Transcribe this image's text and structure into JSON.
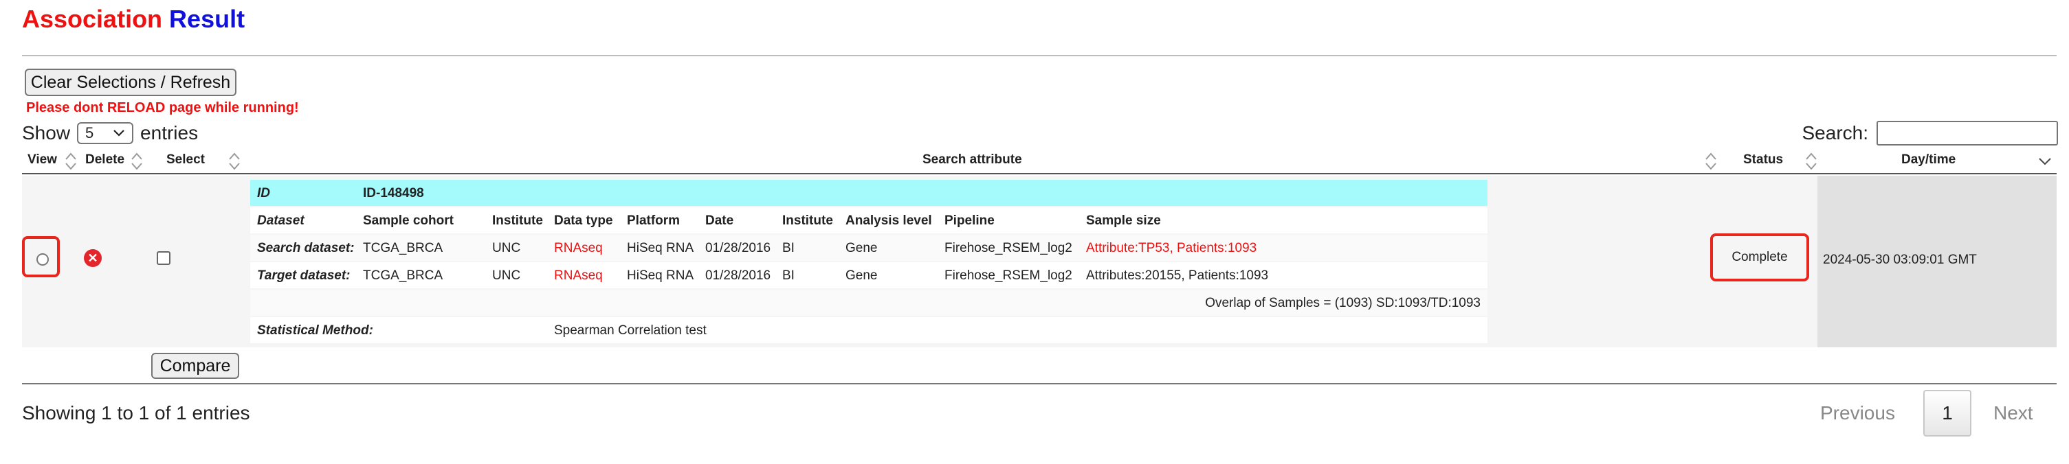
{
  "title": {
    "word1": "Association",
    "word2": "Result"
  },
  "toolbar": {
    "clear_label": "Clear Selections / Refresh",
    "warning": "Please dont RELOAD page while running!"
  },
  "length": {
    "show": "Show",
    "value": "5",
    "entries": "entries"
  },
  "search": {
    "label": "Search:",
    "value": ""
  },
  "table": {
    "headers": {
      "view": "View",
      "delete": "Delete",
      "select": "Select",
      "attribute": "Search attribute",
      "status": "Status",
      "daytime": "Day/time"
    },
    "row": {
      "status": "Complete",
      "daytime": "2024-05-30 03:09:01 GMT",
      "inner": {
        "id_label": "ID",
        "id_value": "ID-148498",
        "columns": [
          "Dataset",
          "Sample cohort",
          "Institute",
          "Data type",
          "Platform",
          "Date",
          "Institute",
          "Analysis level",
          "Pipeline",
          "Sample size"
        ],
        "search": [
          "Search dataset:",
          "TCGA_BRCA",
          "UNC",
          "RNAseq",
          "HiSeq RNA",
          "01/28/2016",
          "BI",
          "Gene",
          "Firehose_RSEM_log2",
          "Attribute:TP53, Patients:1093"
        ],
        "target": [
          "Target dataset:",
          "TCGA_BRCA",
          "UNC",
          "RNAseq",
          "HiSeq RNA",
          "01/28/2016",
          "BI",
          "Gene",
          "Firehose_RSEM_log2",
          "Attributes:20155, Patients:1093"
        ],
        "overlap": "Overlap of Samples = (1093) SD:1093/TD:1093",
        "method_label": "Statistical Method:",
        "method_value": "Spearman Correlation test"
      }
    }
  },
  "compare_label": "Compare",
  "footer": {
    "info": "Showing 1 to 1 of 1 entries",
    "previous": "Previous",
    "page": "1",
    "next": "Next"
  },
  "colors": {
    "title_red": "#ee1111",
    "title_blue": "#1111dd",
    "highlight_red": "#e8261e",
    "id_row_bg": "#a5fbfb"
  }
}
